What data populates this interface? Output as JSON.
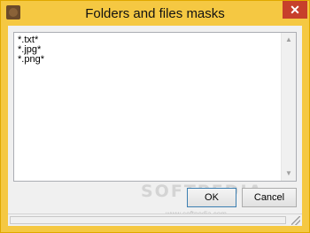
{
  "window": {
    "title": "Folders and files masks",
    "close_glyph": "✕"
  },
  "editor": {
    "lines": [
      "*.txt*",
      "*.jpg*",
      "*.png*"
    ],
    "scroll_up_glyph": "▲",
    "scroll_down_glyph": "▼"
  },
  "buttons": {
    "ok_label": "OK",
    "cancel_label": "Cancel"
  },
  "watermark": {
    "brand": "SOFTPEDIA",
    "url": "www.softpedia.com"
  },
  "colors": {
    "titlebar": "#f5c842",
    "close": "#c7402b"
  }
}
